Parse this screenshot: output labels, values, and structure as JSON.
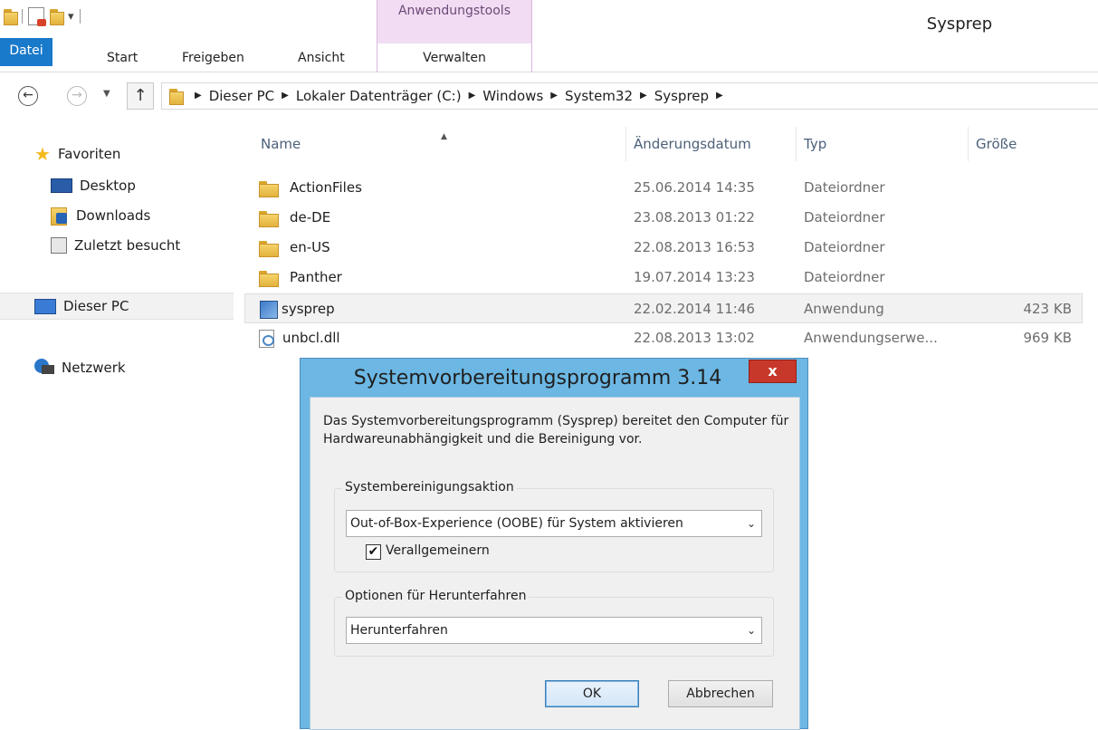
{
  "window": {
    "title": "Sysprep",
    "contextual_tab_group": "Anwendungstools"
  },
  "ribbon": {
    "tabs": [
      "Datei",
      "Start",
      "Freigeben",
      "Ansicht",
      "Verwalten"
    ]
  },
  "address": {
    "crumbs": [
      "Dieser PC",
      "Lokaler Datenträger (C:)",
      "Windows",
      "System32",
      "Sysprep"
    ]
  },
  "nav": {
    "favorites": "Favoriten",
    "desktop": "Desktop",
    "downloads": "Downloads",
    "recent": "Zuletzt besucht",
    "this_pc": "Dieser PC",
    "network": "Netzwerk"
  },
  "list": {
    "columns": {
      "name": "Name",
      "date": "Änderungsdatum",
      "type": "Typ",
      "size": "Größe"
    },
    "rows": [
      {
        "name": "ActionFiles",
        "date": "25.06.2014 14:35",
        "type": "Dateiordner",
        "size": ""
      },
      {
        "name": "de-DE",
        "date": "23.08.2013 01:22",
        "type": "Dateiordner",
        "size": ""
      },
      {
        "name": "en-US",
        "date": "22.08.2013 16:53",
        "type": "Dateiordner",
        "size": ""
      },
      {
        "name": "Panther",
        "date": "19.07.2014 13:23",
        "type": "Dateiordner",
        "size": ""
      },
      {
        "name": "sysprep",
        "date": "22.02.2014 11:46",
        "type": "Anwendung",
        "size": "423 KB"
      },
      {
        "name": "unbcl.dll",
        "date": "22.08.2013 13:02",
        "type": "Anwendungserwe...",
        "size": "969 KB"
      }
    ]
  },
  "dialog": {
    "title": "Systemvorbereitungsprogramm 3.14",
    "close_glyph": "x",
    "description": "Das Systemvorbereitungsprogramm (Sysprep) bereitet den Computer für Hardwareunabhängigkeit und die Bereinigung vor.",
    "cleanup_group": "Systembereinigungsaktion",
    "cleanup_value": "Out-of-Box-Experience (OOBE) für System aktivieren",
    "generalize_label": "Verallgemeinern",
    "generalize_checked": true,
    "shutdown_group": "Optionen für Herunterfahren",
    "shutdown_value": "Herunterfahren",
    "ok_label": "OK",
    "cancel_label": "Abbrechen"
  }
}
